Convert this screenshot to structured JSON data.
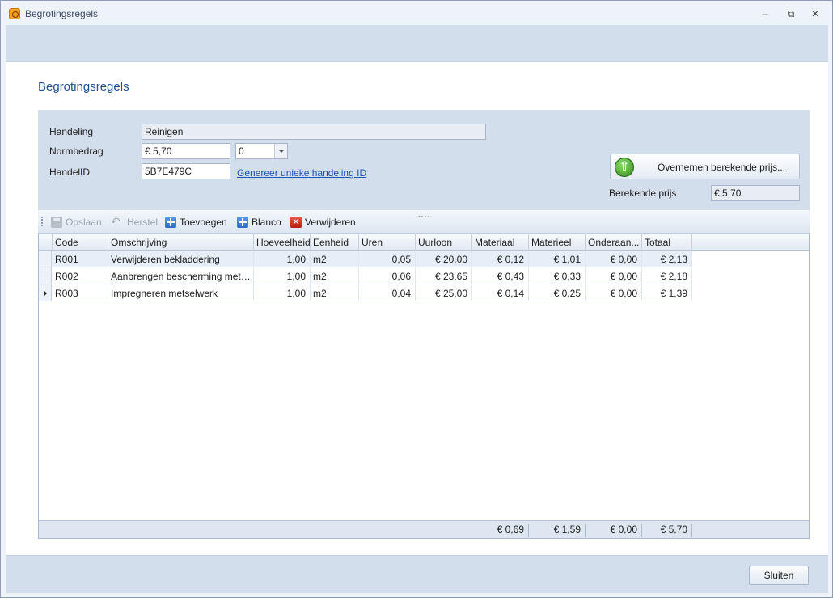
{
  "window": {
    "title": "Begrotingsregels"
  },
  "page": {
    "title": "Begrotingsregels"
  },
  "form": {
    "handeling_label": "Handeling",
    "handeling_value": "Reinigen",
    "normbedrag_label": "Normbedrag",
    "normbedrag_value": "€ 5,70",
    "normbedrag_combo_value": "0",
    "handelid_label": "HandelID",
    "handelid_value": "5B7E479C",
    "generate_link": "Genereer unieke handeling ID",
    "overnemen_button": "Overnemen berekende prijs...",
    "berekende_label": "Berekende prijs",
    "berekende_value": "€ 5,70"
  },
  "toolbar": {
    "opslaan": "Opslaan",
    "herstel": "Herstel",
    "toevoegen": "Toevoegen",
    "blanco": "Blanco",
    "verwijderen": "Verwijderen"
  },
  "grid": {
    "columns": [
      "Code",
      "Omschrijving",
      "Hoeveelheid",
      "Eenheid",
      "Uren",
      "Uurloon",
      "Materiaal",
      "Materieel",
      "Onderaan...",
      "Totaal"
    ],
    "rows": [
      [
        "R001",
        "Verwijderen bekladdering",
        "1,00",
        "m2",
        "0,05",
        "€ 20,00",
        "€ 0,12",
        "€ 1,01",
        "€ 0,00",
        "€ 2,13"
      ],
      [
        "R002",
        "Aanbrengen bescherming met pe...",
        "1,00",
        "m2",
        "0,06",
        "€ 23,65",
        "€ 0,43",
        "€ 0,33",
        "€ 0,00",
        "€ 2,18"
      ],
      [
        "R003",
        "Impregneren metselwerk",
        "1,00",
        "m2",
        "0,04",
        "€ 25,00",
        "€ 0,14",
        "€ 0,25",
        "€ 0,00",
        "€ 1,39"
      ]
    ],
    "footer": {
      "materiaal": "€ 0,69",
      "materieel": "€ 1,59",
      "onderaanneming": "€ 0,00",
      "totaal": "€ 5,70"
    }
  },
  "footer": {
    "close_button": "Sluiten"
  }
}
